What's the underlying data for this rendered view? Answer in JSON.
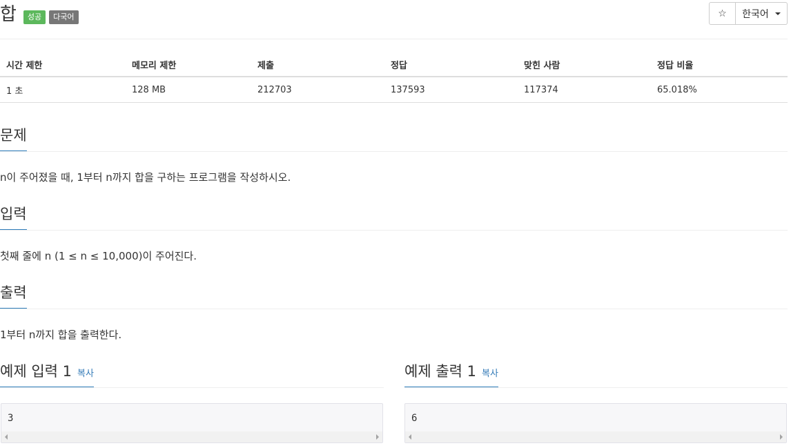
{
  "header": {
    "title": "합",
    "badges": {
      "success": "성공",
      "multilang": "다국어"
    },
    "star_icon": "☆",
    "language_label": "한국어"
  },
  "info_table": {
    "headers": [
      "시간 제한",
      "메모리 제한",
      "제출",
      "정답",
      "맞힌 사람",
      "정답 비율"
    ],
    "values": [
      "1 초",
      "128 MB",
      "212703",
      "137593",
      "117374",
      "65.018%"
    ]
  },
  "sections": {
    "problem": {
      "title": "문제",
      "text": "n이 주어졌을 때, 1부터 n까지 합을 구하는 프로그램을 작성하시오."
    },
    "input": {
      "title": "입력",
      "text": "첫째 줄에 n (1 ≤ n ≤ 10,000)이 주어진다."
    },
    "output": {
      "title": "출력",
      "text": "1부터 n까지 합을 출력한다."
    }
  },
  "samples": {
    "input": {
      "title": "예제 입력 1",
      "copy": "복사",
      "value": "3"
    },
    "output": {
      "title": "예제 출력 1",
      "copy": "복사",
      "value": "6"
    }
  },
  "colors": {
    "badge_success": "#5cb85c",
    "badge_multilang": "#777777",
    "section_underline": "#2b7bb9",
    "link": "#337ab7"
  }
}
